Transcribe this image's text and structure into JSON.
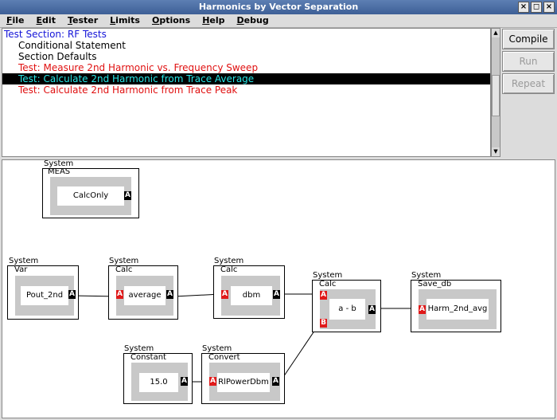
{
  "window": {
    "title": "Harmonics by Vector Separation",
    "buttons": [
      "×",
      "◻",
      "×"
    ]
  },
  "menu": [
    {
      "u": "F",
      "rest": "ile"
    },
    {
      "u": "E",
      "rest": "dit"
    },
    {
      "u": "T",
      "rest": "ester"
    },
    {
      "u": "L",
      "rest": "imits"
    },
    {
      "u": "O",
      "rest": "ptions"
    },
    {
      "u": "H",
      "rest": "elp"
    },
    {
      "u": "D",
      "rest": "ebug"
    }
  ],
  "tests": {
    "section": "Test Section: RF Tests",
    "conditional": "Conditional Statement",
    "defaults": "Section Defaults",
    "test1": "Test: Measure 2nd Harmonic vs. Frequency Sweep",
    "test2": "Test: Calculate 2nd Harmonic from Trace Average",
    "test3": "Test: Calculate 2nd Harmonic from Trace Peak"
  },
  "buttons": {
    "compile": "Compile",
    "run": "Run",
    "repeat": "Repeat"
  },
  "graph": {
    "system": "System",
    "meas": {
      "type": "MEAS",
      "name": "CalcOnly",
      "out": "A"
    },
    "var": {
      "type": "Var",
      "name": "Pout_2nd",
      "out": "A"
    },
    "calc1": {
      "type": "Calc",
      "name": "average",
      "in": "A",
      "out": "A"
    },
    "calc2": {
      "type": "Calc",
      "name": "dbm",
      "in": "A",
      "out": "A"
    },
    "calc3": {
      "type": "Calc",
      "name": "a - b",
      "in_a": "A",
      "in_b": "B",
      "out": "A"
    },
    "save": {
      "type": "Save_db",
      "name": "Harm_2nd_avg",
      "in": "A"
    },
    "const": {
      "type": "Constant",
      "name": "15.0",
      "out": "A"
    },
    "convert": {
      "type": "Convert",
      "name": "RlPowerDbm",
      "in": "A",
      "out": "A"
    }
  }
}
